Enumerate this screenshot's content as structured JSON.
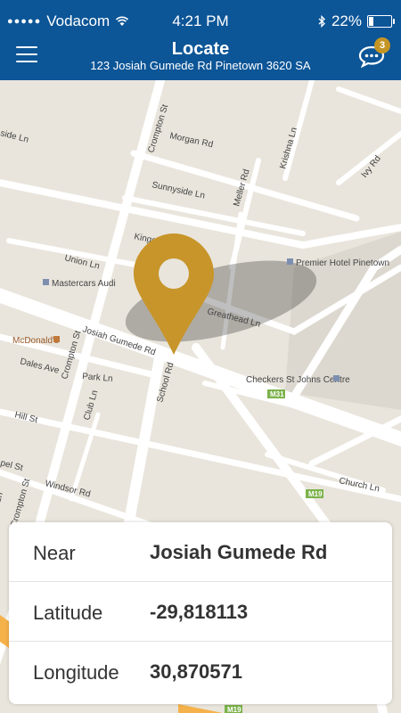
{
  "status_bar": {
    "carrier": "Vodacom",
    "time": "4:21 PM",
    "battery": "22%",
    "battery_level": 0.22
  },
  "header": {
    "title": "Locate",
    "subtitle": "123 Josiah Gumede Rd Pinetown 3620 SA",
    "chat_badge": "3"
  },
  "map": {
    "streets": [
      "Crompton St",
      "Morgan Rd",
      "Krishna Ln",
      "Ivy Rd",
      "Sunnyside Ln",
      "Meller Rd",
      "Kings",
      "Union Ln",
      "Greathead Ln",
      "Josiah Gumede Rd",
      "Dales Ave",
      "Park Ln",
      "School Rd",
      "Club Ln",
      "Crompton St",
      "Hill St",
      "Windsor Rd",
      "Crompton St",
      "Church Ln",
      "side Ln",
      "pel St",
      "Ln"
    ],
    "places": [
      "Premier Hotel Pinetown",
      "Mastercars Audi",
      "McDonald's",
      "Checkers St Johns Centre"
    ],
    "route_shields": [
      "M31",
      "M19",
      "M19"
    ]
  },
  "info": {
    "rows": [
      {
        "label": "Near",
        "value": "Josiah Gumede Rd"
      },
      {
        "label": "Latitude",
        "value": "-29,818113"
      },
      {
        "label": "Longitude",
        "value": "30,870571"
      }
    ]
  },
  "colors": {
    "header": "#0c5597",
    "pin": "#c8952a",
    "badge": "#c59524",
    "map_bg": "#e9e5dc",
    "road": "#ffffff",
    "shield": "#7bb24a"
  }
}
